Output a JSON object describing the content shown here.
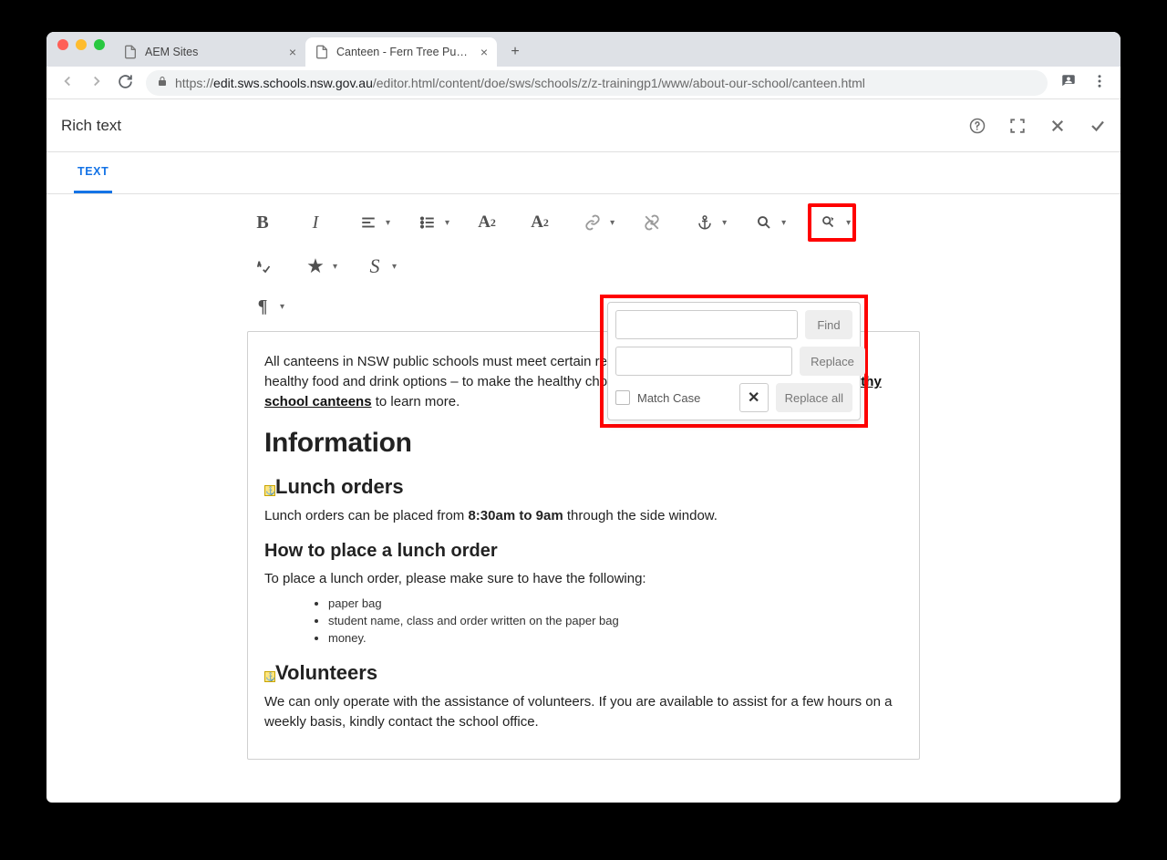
{
  "browser": {
    "tabs": [
      {
        "title": "AEM Sites",
        "active": false
      },
      {
        "title": "Canteen - Fern Tree Public Sch",
        "active": true
      }
    ],
    "url_host": "edit.sws.schools.nsw.gov.au",
    "url_path": "/editor.html/content/doe/sws/schools/z/z-trainingp1/www/about-our-school/canteen.html",
    "url_scheme": "https://"
  },
  "aem": {
    "header_title": "Rich text",
    "tab_label": "TEXT"
  },
  "find_replace": {
    "find_value": "",
    "replace_value": "",
    "find_label": "Find",
    "replace_label": "Replace",
    "replace_all_label": "Replace all",
    "match_case_label": "Match Case"
  },
  "content": {
    "intro_pre": "All canteens in NSW public schools must meet certain requirements. This includes providing more healthy food and drink options – to make the healthy choice an easy choice for students. Visit ",
    "intro_link": "Healthy school canteens",
    "intro_post": " to learn more.",
    "h2_info": "Information",
    "h3_lunch": "Lunch orders",
    "lunch_p_pre": "Lunch orders can be placed from ",
    "lunch_p_bold": "8:30am to 9am",
    "lunch_p_post": " through the side window.",
    "h4_howto": "How to place a lunch order",
    "howto_p": "To place a lunch order, please make sure to have the following:",
    "items": [
      "paper bag",
      "student name, class and order written on the paper bag",
      "money."
    ],
    "h3_volunteers": "Volunteers",
    "volunteers_p": "We can only operate with the assistance of volunteers. If you are available to assist for a few hours on a weekly basis, kindly contact the school office."
  }
}
